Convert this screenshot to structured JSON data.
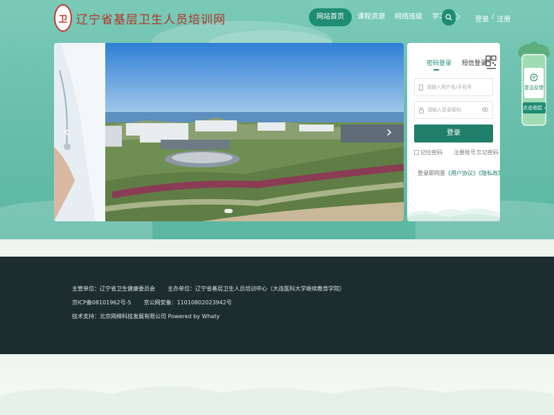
{
  "header": {
    "logo_seal": "卫",
    "logo_text": "辽宁省基层卫生人员培训网",
    "nav": [
      {
        "label": "网站首页",
        "active": true
      },
      {
        "label": "课程资源",
        "active": false
      },
      {
        "label": "网络班级",
        "active": false
      },
      {
        "label": "学习中心",
        "active": false
      }
    ],
    "search_icon": "search-icon",
    "login_label": "登录",
    "separator": "/",
    "register_label": "注册"
  },
  "carousel": {
    "prev_arrow": "‹",
    "next_arrow": "›",
    "dots": 2,
    "active_dot": 0
  },
  "login": {
    "tabs": [
      "密码登录",
      "短信登录"
    ],
    "active_tab": 0,
    "qr_icon": "qrcode-icon",
    "username_placeholder": "请输入用户名/手机号",
    "password_placeholder": "请输入登录密码",
    "submit_label": "登录",
    "remember_label": "记住密码",
    "register_label": "注册账号",
    "forgot_label": "忘记密码",
    "agree_prefix": "登录即同意",
    "user_agreement": "《用户协议》",
    "privacy_policy": "《隐私政策》"
  },
  "float": {
    "feedback_label": "意见反馈",
    "collapse_label": "点击收起 ›"
  },
  "footer": {
    "sponsor": "主管单位：辽宁省卫生健康委员会",
    "organizer": "主办单位：辽宁省基层卫生人员培训中心（大连医科大学继续教育学院）",
    "icp": "京ICP备08101962号-5",
    "police": "京公网安备：11010802023942号",
    "tech": "技术支持：北京网梯科技发展有限公司 Powered by Whaty"
  },
  "colors": {
    "brand": "#1f8c74",
    "hero": "#6cc0ae",
    "footer": "#1d2d2e"
  }
}
